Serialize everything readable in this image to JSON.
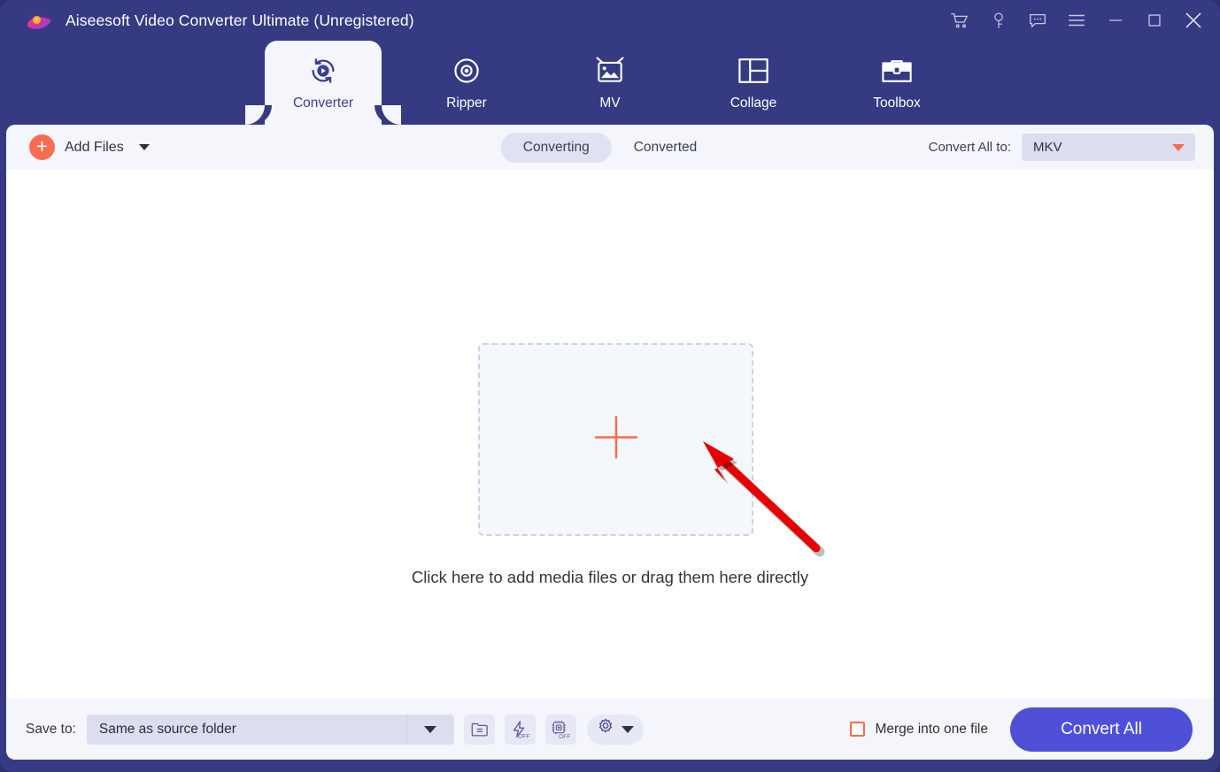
{
  "window": {
    "title": "Aiseesoft Video Converter Ultimate (Unregistered)",
    "frame_color": "#363a82",
    "accent_color": "#4f50d8",
    "orange_color": "#f96c4b"
  },
  "titlebar": {
    "logo_name": "aiseesoft-logo",
    "actions": [
      {
        "name": "cart-icon",
        "label": "Cart"
      },
      {
        "name": "key-icon",
        "label": "Register"
      },
      {
        "name": "feedback-icon",
        "label": "Feedback"
      },
      {
        "name": "menu-icon",
        "label": "Menu"
      },
      {
        "name": "minimize-icon",
        "label": "Minimize"
      },
      {
        "name": "maximize-icon",
        "label": "Maximize"
      },
      {
        "name": "close-icon",
        "label": "Close"
      }
    ]
  },
  "nav": {
    "tabs": [
      {
        "label": "Converter",
        "icon": "converter-icon",
        "active": true
      },
      {
        "label": "Ripper",
        "icon": "ripper-icon",
        "active": false
      },
      {
        "label": "MV",
        "icon": "mv-icon",
        "active": false
      },
      {
        "label": "Collage",
        "icon": "collage-icon",
        "active": false
      },
      {
        "label": "Toolbox",
        "icon": "toolbox-icon",
        "active": false
      }
    ]
  },
  "toolbar": {
    "add_files_label": "Add Files",
    "add_files_icon": "plus-circle-icon",
    "add_files_caret": "chevron-down-icon",
    "segments": [
      {
        "label": "Converting",
        "active": true
      },
      {
        "label": "Converted",
        "active": false
      }
    ],
    "convert_all_to_label": "Convert All to:",
    "format_value": "MKV",
    "format_caret": "caret-down-icon"
  },
  "stage": {
    "dropzone_icon": "plus-icon",
    "hint": "Click here to add media files or drag them here directly",
    "annotation": "red-arrow-pointer"
  },
  "bottombar": {
    "save_to_label": "Save to:",
    "save_to_value": "Same as source folder",
    "save_to_caret": "caret-down-icon",
    "buttons": [
      {
        "name": "open-folder-icon",
        "label": "Open output folder"
      },
      {
        "name": "hardware-accel-icon",
        "label": "OFF"
      },
      {
        "name": "gpu-accel-icon",
        "label": "OFF"
      },
      {
        "name": "preferences-gear-icon",
        "label": "Preferences"
      }
    ],
    "merge_label": "Merge into one file",
    "merge_checked": false,
    "convert_all_label": "Convert All"
  }
}
